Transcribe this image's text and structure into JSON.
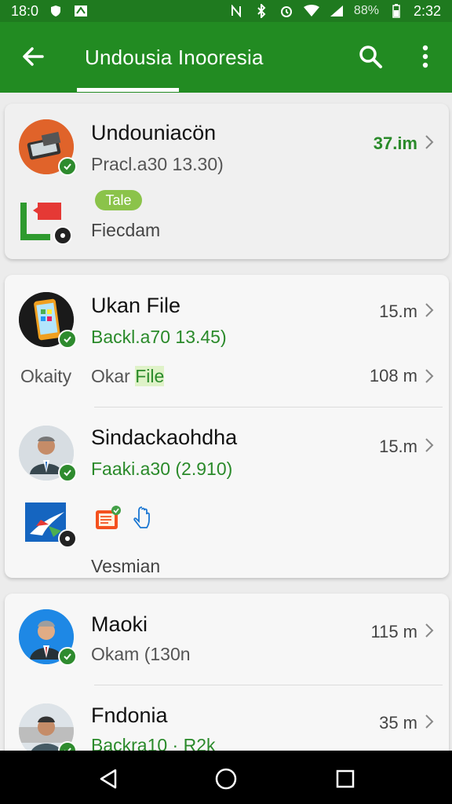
{
  "status_bar": {
    "time_left": "18:0",
    "battery": "88%",
    "time_right": "2:32"
  },
  "app_bar": {
    "title": "Undousia Inooresia"
  },
  "cards": [
    {
      "rows": [
        {
          "name": "Undouniacön",
          "sub": "Pracl.a30 13.30)",
          "meta": "37.im",
          "pill": "Tale"
        },
        {
          "name": "Fiecdam"
        }
      ]
    },
    {
      "rows": [
        {
          "name": "Ukan File",
          "sub": "Backl.a70 13.45)",
          "meta": "15.m"
        },
        {
          "label_left": "Okaity",
          "name_prefix": "Okar",
          "name_highlight": "File",
          "meta": "108 m"
        },
        {
          "name": "Sindackaohdha",
          "sub": "Faaki.a30  (2.910)",
          "meta": "15.m"
        },
        {
          "name": "Vesmian"
        }
      ]
    },
    {
      "rows": [
        {
          "name": "Maoki",
          "sub": "Okam (130n",
          "meta": "115 m"
        },
        {
          "name": "Fndonia",
          "sub": "Backra10 · R2k",
          "meta": "35 m"
        }
      ]
    }
  ],
  "colors": {
    "status_bar": "#1f7a1f",
    "app_bar": "#228b22",
    "accent_green": "#2a8a2a",
    "pill": "#8bc34a"
  },
  "icons": [
    "back-arrow-icon",
    "search-icon",
    "more-vert-icon",
    "chevron-right-icon",
    "check-badge-icon",
    "nav-back-icon",
    "nav-home-icon",
    "nav-recents-icon"
  ]
}
